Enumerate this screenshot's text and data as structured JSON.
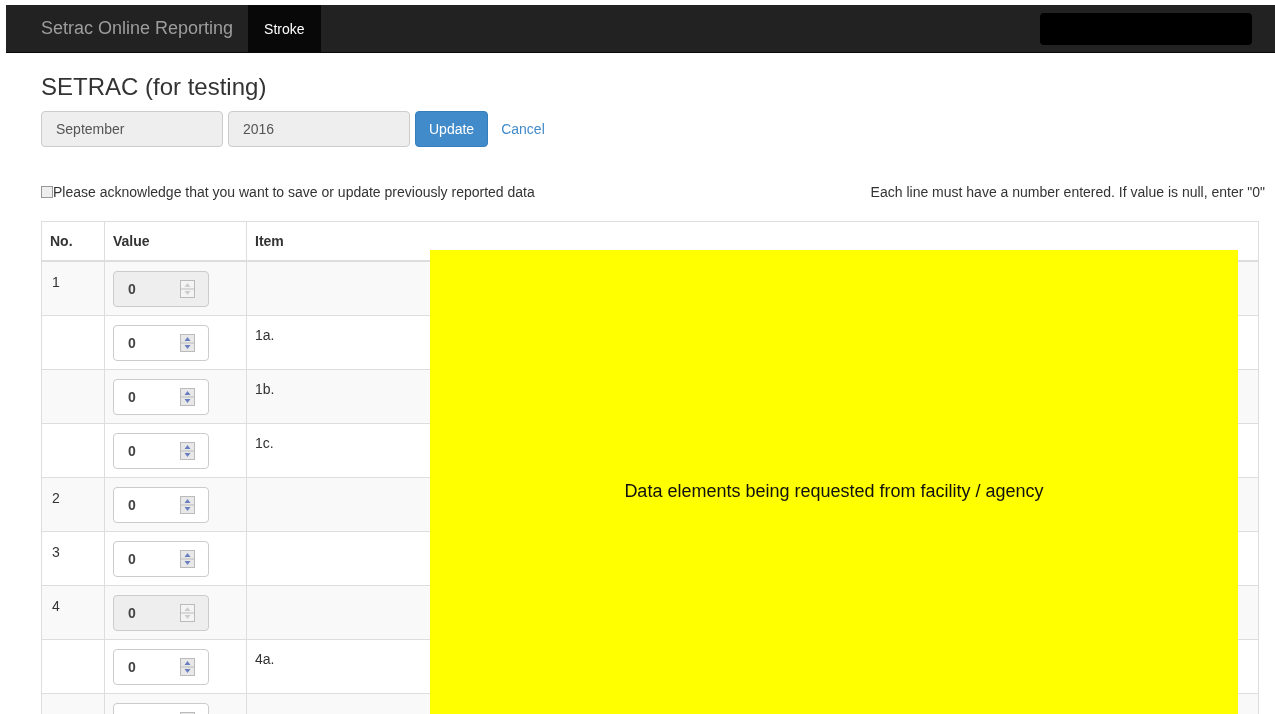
{
  "navbar": {
    "brand": "Setrac Online Reporting",
    "items": [
      {
        "label": "Stroke",
        "selected": true
      }
    ]
  },
  "heading": "SETRAC (for testing)",
  "period": {
    "month": "September",
    "year": "2016",
    "update_button": "Update",
    "cancel_link": "Cancel"
  },
  "acknowledge": {
    "label": "Please acknowledge that you want to save or update previously reported data",
    "checked": false
  },
  "instruction": "Each line must have a number entered. If value is null, enter \"0\"",
  "table": {
    "columns": [
      "No.",
      "Value",
      "Item"
    ],
    "rows": [
      {
        "no": "1",
        "value": "0",
        "disabled": true
      },
      {
        "value": "0",
        "item": "1a.",
        "disabled": false
      },
      {
        "value": "0",
        "item": "1b.",
        "disabled": false
      },
      {
        "value": "0",
        "item": "1c.",
        "disabled": false
      },
      {
        "no": "2",
        "value": "0",
        "disabled": false
      },
      {
        "no": "3",
        "value": "0",
        "disabled": false
      },
      {
        "no": "4",
        "value": "0",
        "disabled": true
      },
      {
        "value": "0",
        "item": "4a.",
        "disabled": false
      },
      {
        "disabled": false
      }
    ]
  },
  "overlay_note": "Data elements being requested from facility / agency"
}
